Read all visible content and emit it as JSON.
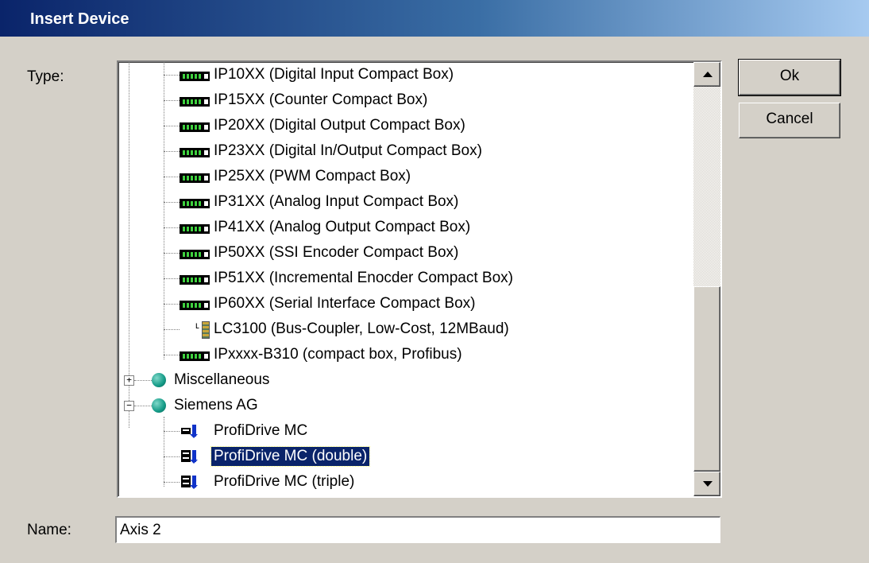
{
  "window": {
    "title": "Insert Device"
  },
  "labels": {
    "type": "Type:",
    "name": "Name:"
  },
  "buttons": {
    "ok": "Ok",
    "cancel": "Cancel"
  },
  "tree": {
    "items": [
      {
        "label": "IP10XX (Digital Input Compact Box)",
        "icon": "compact-box-icon"
      },
      {
        "label": "IP15XX (Counter Compact Box)",
        "icon": "compact-box-icon"
      },
      {
        "label": "IP20XX (Digital Output Compact Box)",
        "icon": "compact-box-icon"
      },
      {
        "label": "IP23XX (Digital In/Output Compact Box)",
        "icon": "compact-box-icon"
      },
      {
        "label": "IP25XX (PWM Compact Box)",
        "icon": "compact-box-icon"
      },
      {
        "label": "IP31XX (Analog Input Compact Box)",
        "icon": "compact-box-icon"
      },
      {
        "label": "IP41XX (Analog Output Compact Box)",
        "icon": "compact-box-icon"
      },
      {
        "label": "IP50XX (SSI Encoder Compact Box)",
        "icon": "compact-box-icon"
      },
      {
        "label": "IP51XX (Incremental Enocder Compact Box)",
        "icon": "compact-box-icon"
      },
      {
        "label": "IP60XX (Serial Interface Compact Box)",
        "icon": "compact-box-icon"
      },
      {
        "label": "LC3100 (Bus-Coupler, Low-Cost, 12MBaud)",
        "icon": "bus-coupler-icon"
      },
      {
        "label": "IPxxxx-B310 (compact box, Profibus)",
        "icon": "compact-box-icon"
      },
      {
        "label": "Miscellaneous",
        "icon": "globe-icon",
        "expander": "+"
      },
      {
        "label": "Siemens AG",
        "icon": "globe-icon",
        "expander": "−"
      },
      {
        "label": "ProfiDrive MC",
        "icon": "drive-icon"
      },
      {
        "label": "ProfiDrive MC (double)",
        "icon": "drive-double-icon",
        "selected": true
      },
      {
        "label": "ProfiDrive MC (triple)",
        "icon": "drive-triple-icon"
      }
    ]
  },
  "name_field": {
    "value": "Axis 2"
  },
  "scrollbar": {
    "position_fraction": 0.52,
    "visible_fraction": 0.43
  }
}
